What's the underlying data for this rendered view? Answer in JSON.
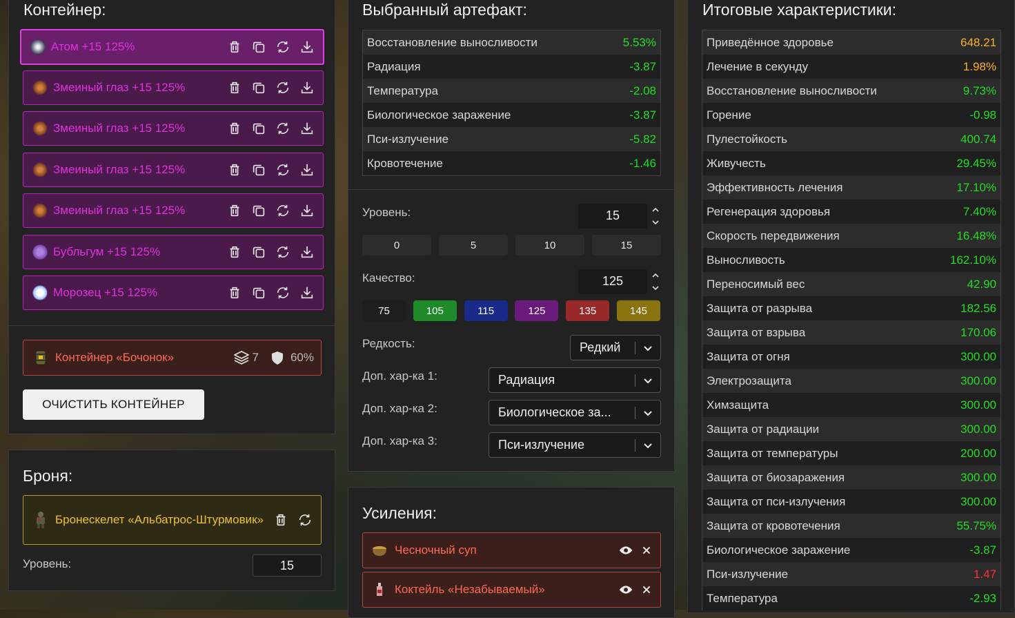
{
  "container": {
    "title": "Контейнер:",
    "artifacts": [
      {
        "name": "Атом +15 125%",
        "icon": "atom-icon",
        "icon_color": "#c9c9e0"
      },
      {
        "name": "Змеиный глаз +15 125%",
        "icon": "snake-eye-icon",
        "icon_color": "#b06a30"
      },
      {
        "name": "Змеиный глаз +15 125%",
        "icon": "snake-eye-icon",
        "icon_color": "#b06a30"
      },
      {
        "name": "Змеиный глаз +15 125%",
        "icon": "snake-eye-icon",
        "icon_color": "#b06a30"
      },
      {
        "name": "Змеиный глаз +15 125%",
        "icon": "snake-eye-icon",
        "icon_color": "#b06a30"
      },
      {
        "name": "Бубльгум +15 125%",
        "icon": "bubblegum-icon",
        "icon_color": "#9a6ad0"
      },
      {
        "name": "Морозец +15 125%",
        "icon": "frost-icon",
        "icon_color": "#ffffff"
      }
    ],
    "container_item": {
      "name": "Контейнер «Бочонок»",
      "slots": "7",
      "protection": "60%"
    },
    "clear_button": "ОЧИСТИТЬ КОНТЕЙНЕР"
  },
  "armor": {
    "title": "Броня:",
    "name": "Бронескелет «Альбатрос-Штурмовик»",
    "level_label": "Уровень:",
    "level_value": "15"
  },
  "selected": {
    "title": "Выбранный артефакт:",
    "stats": [
      {
        "label": "Восстановление выносливости",
        "value": "5.53%"
      },
      {
        "label": "Радиация",
        "value": "-3.87"
      },
      {
        "label": "Температура",
        "value": "-2.08"
      },
      {
        "label": "Биологическое заражение",
        "value": "-3.87"
      },
      {
        "label": "Пси-излучение",
        "value": "-5.82"
      },
      {
        "label": "Кровотечение",
        "value": "-1.46"
      }
    ],
    "level_label": "Уровень:",
    "level_value": "15",
    "level_presets": [
      "0",
      "5",
      "10",
      "15"
    ],
    "quality_label": "Качество:",
    "quality_value": "125",
    "quality_presets": [
      {
        "label": "75",
        "color": "#1e1e1e"
      },
      {
        "label": "105",
        "color": "#1f8a2a"
      },
      {
        "label": "115",
        "color": "#1a2a8a"
      },
      {
        "label": "125",
        "color": "#6a1a7a"
      },
      {
        "label": "135",
        "color": "#9a2a2a"
      },
      {
        "label": "145",
        "color": "#8a7410"
      }
    ],
    "rarity_label": "Редкость:",
    "rarity_value": "Редкий",
    "extra1_label": "Доп. хар-ка 1:",
    "extra1_value": "Радиация",
    "extra2_label": "Доп. хар-ка 2:",
    "extra2_value": "Биологическое за...",
    "extra3_label": "Доп. хар-ка 3:",
    "extra3_value": "Пси-излучение"
  },
  "boosts": {
    "title": "Усиления:",
    "items": [
      {
        "name": "Чесночный суп",
        "icon": "soup-icon"
      },
      {
        "name": "Коктейль «Незабываемый»",
        "icon": "bottle-icon"
      }
    ]
  },
  "totals": {
    "title": "Итоговые характеристики:",
    "stats": [
      {
        "label": "Приведённое здоровье",
        "value": "648.21",
        "color": "orange"
      },
      {
        "label": "Лечение в секунду",
        "value": "1.98%",
        "color": "orange"
      },
      {
        "label": "Восстановление выносливости",
        "value": "9.73%",
        "color": "green"
      },
      {
        "label": "Горение",
        "value": "-0.98",
        "color": "green"
      },
      {
        "label": "Пулестойкость",
        "value": "400.74",
        "color": "green"
      },
      {
        "label": "Живучесть",
        "value": "29.45%",
        "color": "green"
      },
      {
        "label": "Эффективность лечения",
        "value": "17.10%",
        "color": "green"
      },
      {
        "label": "Регенерация здоровья",
        "value": "7.40%",
        "color": "green"
      },
      {
        "label": "Скорость передвижения",
        "value": "16.48%",
        "color": "green"
      },
      {
        "label": "Выносливость",
        "value": "162.10%",
        "color": "green"
      },
      {
        "label": "Переносимый вес",
        "value": "42.90",
        "color": "green"
      },
      {
        "label": "Защита от разрыва",
        "value": "182.56",
        "color": "green"
      },
      {
        "label": "Защита от взрыва",
        "value": "170.06",
        "color": "green"
      },
      {
        "label": "Защита от огня",
        "value": "300.00",
        "color": "green"
      },
      {
        "label": "Электрозащита",
        "value": "300.00",
        "color": "green"
      },
      {
        "label": "Химзащита",
        "value": "300.00",
        "color": "green"
      },
      {
        "label": "Защита от радиации",
        "value": "300.00",
        "color": "green"
      },
      {
        "label": "Защита от температуры",
        "value": "200.00",
        "color": "green"
      },
      {
        "label": "Защита от биозаражения",
        "value": "300.00",
        "color": "green"
      },
      {
        "label": "Защита от пси-излучения",
        "value": "300.00",
        "color": "green"
      },
      {
        "label": "Защита от кровотечения",
        "value": "55.75%",
        "color": "green"
      },
      {
        "label": "Биологическое заражение",
        "value": "-3.87",
        "color": "green"
      },
      {
        "label": "Пси-излучение",
        "value": "1.47",
        "color": "red"
      },
      {
        "label": "Температура",
        "value": "-2.93",
        "color": "green"
      }
    ]
  }
}
